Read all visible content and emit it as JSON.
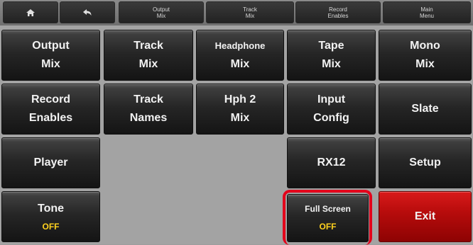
{
  "topbar": {
    "home_icon": "home-icon",
    "back_icon": "back-arrow-icon",
    "tabs": [
      {
        "line1": "Output",
        "line2": "Mix"
      },
      {
        "line1": "Track",
        "line2": "Mix"
      },
      {
        "line1": "Record",
        "line2": "Enables"
      },
      {
        "line1": "Main",
        "line2": "Menu"
      }
    ]
  },
  "grid": {
    "output_mix": {
      "line1": "Output",
      "line2": "Mix"
    },
    "track_mix": {
      "line1": "Track",
      "line2": "Mix"
    },
    "headphone_mix": {
      "line1": "Headphone",
      "line2": "Mix"
    },
    "tape_mix": {
      "line1": "Tape",
      "line2": "Mix"
    },
    "mono_mix": {
      "line1": "Mono",
      "line2": "Mix"
    },
    "record_enables": {
      "line1": "Record",
      "line2": "Enables"
    },
    "track_names": {
      "line1": "Track",
      "line2": "Names"
    },
    "hph2_mix": {
      "line1": "Hph 2",
      "line2": "Mix"
    },
    "input_config": {
      "line1": "Input",
      "line2": "Config"
    },
    "slate": {
      "label": "Slate"
    },
    "player": {
      "label": "Player"
    },
    "rx12": {
      "label": "RX12"
    },
    "setup": {
      "label": "Setup"
    },
    "tone": {
      "label": "Tone",
      "value": "OFF"
    },
    "full_screen": {
      "label": "Full Screen",
      "value": "OFF"
    },
    "exit": {
      "label": "Exit"
    }
  },
  "colors": {
    "value_text": "#ffd21e",
    "highlight": "#e3001b",
    "exit": "#b80c0c"
  }
}
